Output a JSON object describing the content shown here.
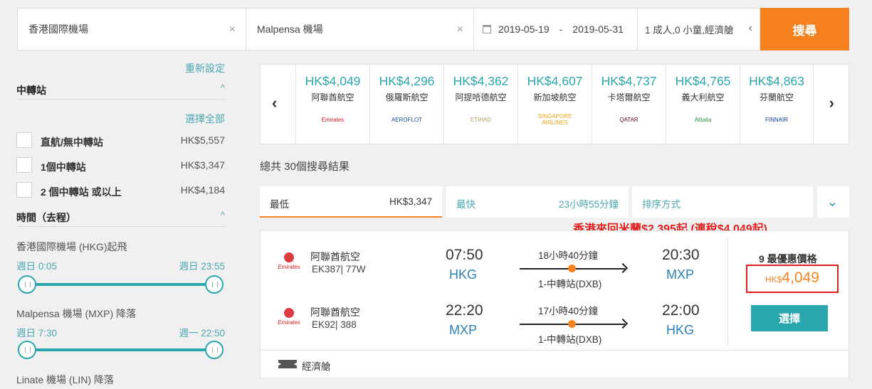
{
  "search": {
    "origin": "香港國際機場",
    "destination": "Malpensa 機場",
    "depart_date": "2019-05-19",
    "date_separator": "-",
    "return_date": "2019-05-31",
    "passengers": "1 成人,0 小童,經濟艙",
    "search_label": "搜尋",
    "clear_glyph": "×",
    "chevron_glyph": "‹"
  },
  "sidebar": {
    "reset_label": "重新設定",
    "stops_title": "中轉站",
    "select_all": "選擇全部",
    "stops": [
      {
        "label": "直航/無中轉站",
        "price": "HK$5,557",
        "checked": false
      },
      {
        "label": "1個中轉站",
        "price": "HK$3,347",
        "checked": false
      },
      {
        "label": "2 個中轉站 或以上",
        "price": "HK$4,184",
        "checked": false
      }
    ],
    "time_title": "時間（去程）",
    "sliders": [
      {
        "label": "香港國際機場 (HKG)起飛",
        "min": "週日 0:05",
        "max": "週日 23:55"
      },
      {
        "label": "Malpensa 機場 (MXP) 降落",
        "min": "週日 7:30",
        "max": "週一 22:50"
      }
    ],
    "third_label": "Linate 機場 (LIN) 降落",
    "caret_glyph": "^"
  },
  "carousel": {
    "prev_glyph": "‹",
    "next_glyph": "›",
    "airlines": [
      {
        "price": "HK$4,049",
        "name": "阿聯酋航空",
        "logo": "Emirates",
        "color": "#d71921"
      },
      {
        "price": "HK$4,296",
        "name": "俄羅斯航空",
        "logo": "AEROFLOT",
        "color": "#1b4f9c"
      },
      {
        "price": "HK$4,362",
        "name": "阿提哈德航空",
        "logo": "ETIHAD",
        "color": "#b49a5c"
      },
      {
        "price": "HK$4,607",
        "name": "新加坡航空",
        "logo": "SINGAPORE AIRLINES",
        "color": "#e8a517"
      },
      {
        "price": "HK$4,737",
        "name": "卡塔爾航空",
        "logo": "QATAR",
        "color": "#5c0a34"
      },
      {
        "price": "HK$4,765",
        "name": "義大利航空",
        "logo": "Alitalia",
        "color": "#2b8a3e"
      },
      {
        "price": "HK$4,863",
        "name": "芬蘭航空",
        "logo": "FINNAIR",
        "color": "#0b3c8c"
      }
    ]
  },
  "total_results": "總共 30個搜尋結果",
  "sort": {
    "cheapest_label": "最低",
    "cheapest_value": "HK$3,347",
    "fastest_label": "最快",
    "fastest_value": "23小時55分鐘",
    "sort_label": "排序方式",
    "expand_glyph": "⌄"
  },
  "promo": "香港來回米蘭$2,395起 (連稅$4,049起)",
  "result": {
    "outbound": {
      "airline": "阿聯酋航空",
      "flight": "EK387| 77W",
      "dep_time": "07:50",
      "dep_code": "HKG",
      "duration": "18小時40分鐘",
      "stops": "1-中轉站(DXB)",
      "arr_time": "20:30",
      "arr_code": "MXP",
      "logo": "Emirates"
    },
    "inbound": {
      "airline": "阿聯酋航空",
      "flight": "EK92| 388",
      "dep_time": "22:20",
      "dep_code": "MXP",
      "duration": "17小時40分鐘",
      "stops": "1-中轉站(DXB)",
      "arr_time": "22:00",
      "arr_code": "HKG",
      "logo": "Emirates"
    },
    "best_price_label": "9 最優惠價格",
    "currency": "HK$",
    "price": "4,049",
    "select_label": "選擇",
    "cabin": "經濟艙"
  },
  "colors": {
    "accent_orange": "#f5821f",
    "teal": "#2aa7ad",
    "promo_red": "#e0201f"
  }
}
